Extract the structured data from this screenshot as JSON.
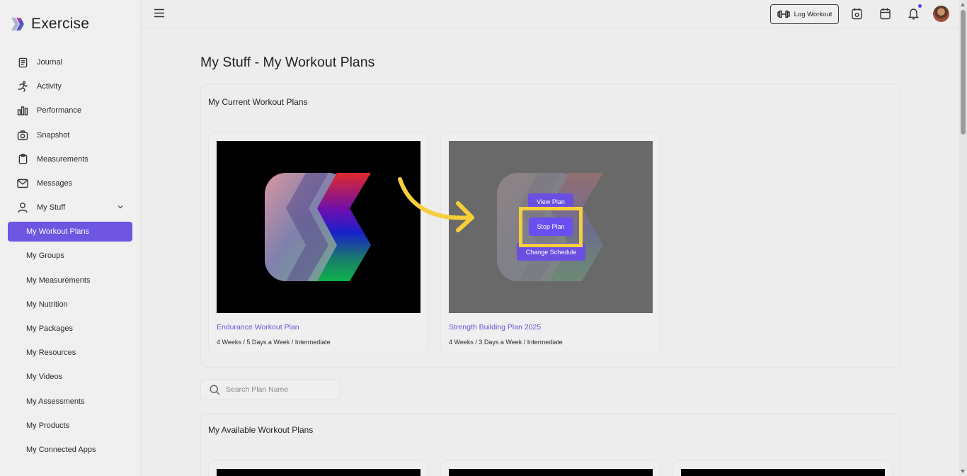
{
  "app": {
    "brand_name": "Exercise"
  },
  "sidebar": {
    "items": [
      {
        "label": "Journal",
        "icon": "journal-icon"
      },
      {
        "label": "Activity",
        "icon": "running-icon"
      },
      {
        "label": "Performance",
        "icon": "bar-chart-icon"
      },
      {
        "label": "Snapshot",
        "icon": "camera-icon"
      },
      {
        "label": "Measurements",
        "icon": "clipboard-icon"
      },
      {
        "label": "Messages",
        "icon": "mail-icon"
      },
      {
        "label": "My Stuff",
        "icon": "user-icon",
        "expanded": true
      }
    ],
    "sub_items": [
      {
        "label": "My Workout Plans",
        "active": true
      },
      {
        "label": "My Groups"
      },
      {
        "label": "My Measurements"
      },
      {
        "label": "My Nutrition"
      },
      {
        "label": "My Packages"
      },
      {
        "label": "My Resources"
      },
      {
        "label": "My Videos"
      },
      {
        "label": "My Assessments"
      },
      {
        "label": "My Products"
      },
      {
        "label": "My Connected Apps"
      }
    ]
  },
  "topbar": {
    "log_workout_label": "Log Workout",
    "icons": [
      "menu-icon",
      "dumbbell-icon",
      "calendar-clock-icon",
      "calendar-icon",
      "bell-icon"
    ]
  },
  "main": {
    "page_title": "My Stuff - My Workout Plans",
    "current_section_title": "My Current Workout Plans",
    "current_plans": [
      {
        "title": "Endurance Workout Plan",
        "meta": "4 Weeks / 5 Days a Week / Intermediate"
      },
      {
        "title": "Strength Building Plan 2025",
        "meta": "4 Weeks / 3 Days a Week / Intermediate"
      }
    ],
    "hover_menu": {
      "view_label": "View Plan",
      "stop_label": "Stop Plan",
      "change_label": "Change Schedule"
    },
    "search": {
      "placeholder": "Search Plan Name",
      "value": ""
    },
    "available_section_title": "My Available Workout Plans"
  },
  "colors": {
    "accent": "#6e55e2",
    "highlight": "#f6cf3b",
    "arrow": "#f6cf3b"
  }
}
